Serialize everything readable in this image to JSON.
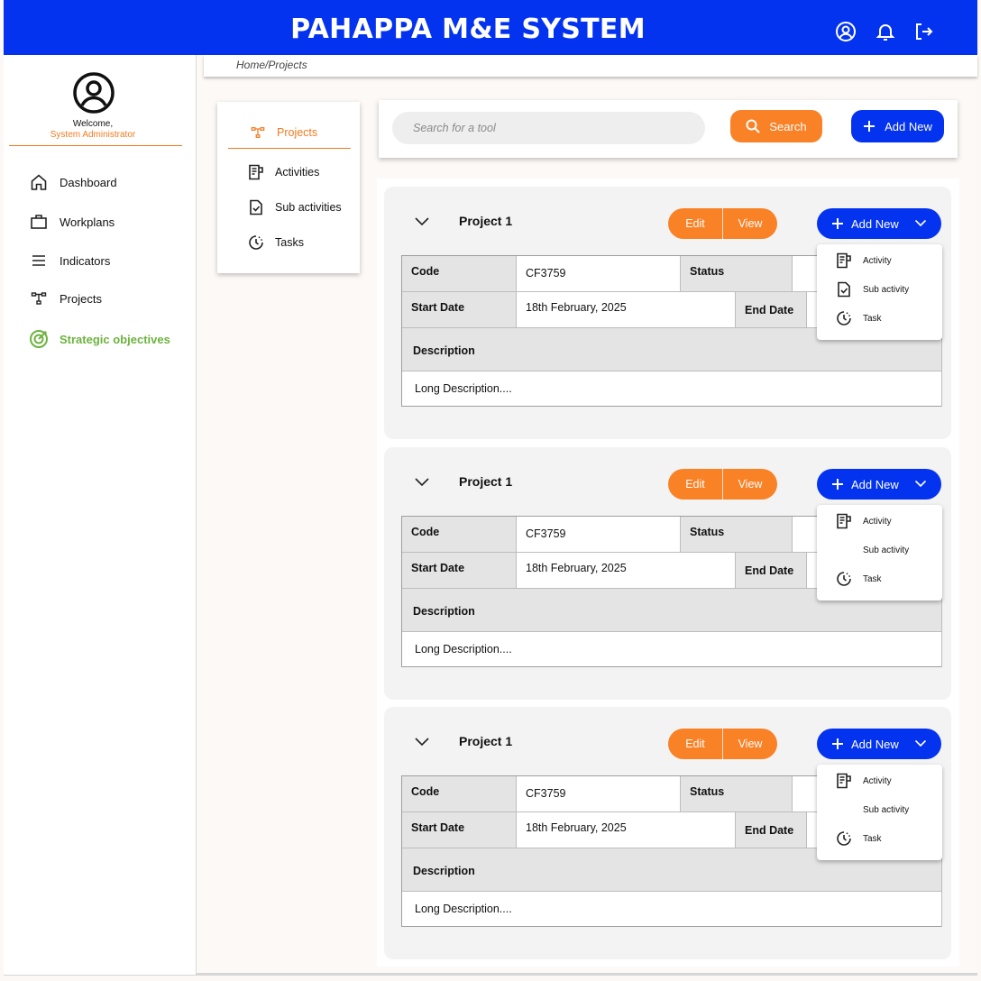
{
  "header": {
    "title": "PAHAPPA M&E SYSTEM"
  },
  "user": {
    "welcome": "Welcome,",
    "role": "System Administrator"
  },
  "sidebar": {
    "items": [
      {
        "label": "Dashboard",
        "icon": "home-icon"
      },
      {
        "label": "Workplans",
        "icon": "briefcase-icon"
      },
      {
        "label": "Indicators",
        "icon": "menu-icon"
      },
      {
        "label": "Projects",
        "icon": "hierarchy-icon"
      },
      {
        "label": "Strategic objectives",
        "icon": "target-icon",
        "color": "#6db33f"
      }
    ]
  },
  "breadcrumb": "Home/Projects",
  "submenu": {
    "items": [
      {
        "label": "Projects",
        "active": true
      },
      {
        "label": "Activities"
      },
      {
        "label": "Sub activities"
      },
      {
        "label": "Tasks"
      }
    ]
  },
  "search": {
    "placeholder": "Search for a tool",
    "button": "Search",
    "add_new": "Add New"
  },
  "colors": {
    "primary": "#0433f0",
    "accent": "#f98126",
    "success": "#6db33f"
  },
  "projects": [
    {
      "title": "Project 1",
      "edit": "Edit",
      "view": "View",
      "add_new": "Add New",
      "code_label": "Code",
      "code": "CF3759",
      "status_label": "Status",
      "start_label": "Start Date",
      "start": "18th February, 2025",
      "end_label": "End Date",
      "desc_label": "Description",
      "desc": "Long Description....",
      "menu": [
        "Activity",
        "Sub activity",
        "Task"
      ]
    },
    {
      "title": "Project 1",
      "edit": "Edit",
      "view": "View",
      "add_new": "Add New",
      "code_label": "Code",
      "code": "CF3759",
      "status_label": "Status",
      "start_label": "Start Date",
      "start": "18th February, 2025",
      "end_label": "End Date",
      "desc_label": "Description",
      "desc": "Long Description....",
      "menu": [
        "Activity",
        "Sub activity",
        "Task"
      ]
    },
    {
      "title": "Project 1",
      "edit": "Edit",
      "view": "View",
      "add_new": "Add New",
      "code_label": "Code",
      "code": "CF3759",
      "status_label": "Status",
      "start_label": "Start Date",
      "start": "18th February, 2025",
      "end_label": "End Date",
      "desc_label": "Description",
      "desc": "Long Description....",
      "menu": [
        "Activity",
        "Sub activity",
        "Task"
      ]
    }
  ]
}
